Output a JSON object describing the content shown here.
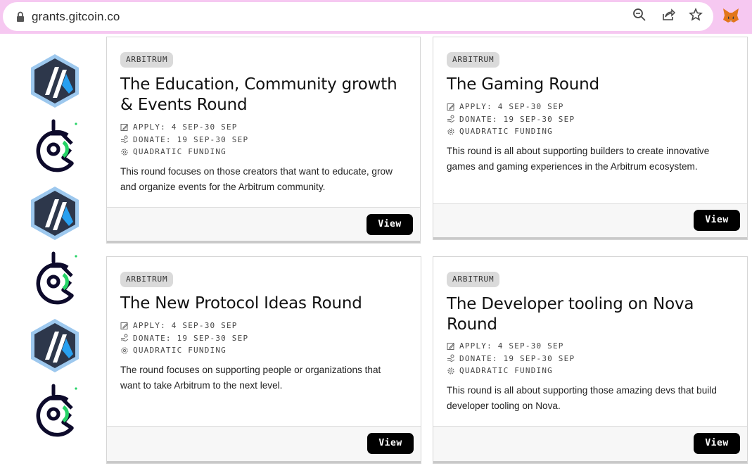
{
  "browser": {
    "url": "grants.gitcoin.co",
    "icons": [
      "lock-icon",
      "zoom-out-icon",
      "share-icon",
      "bookmark-star-icon",
      "metamask-fox-icon"
    ]
  },
  "sidebar": {
    "logos": [
      "arbitrum-logo-icon",
      "gitcoin-logo-icon",
      "arbitrum-logo-icon",
      "gitcoin-logo-icon",
      "arbitrum-logo-icon",
      "gitcoin-logo-icon"
    ]
  },
  "rounds": [
    {
      "tag": "ARBITRUM",
      "title_line1": "The Education, Community growth",
      "title_line2": "& Events Round",
      "apply": "APPLY: 4 SEP-30 SEP",
      "donate": "DONATE: 19 SEP-30 SEP",
      "funding": "QUADRATIC FUNDING",
      "desc_line1": "This round focuses on those creators that want to educate, grow",
      "desc_line2": "and organize events for the Arbitrum community.",
      "button": "View"
    },
    {
      "tag": "ARBITRUM",
      "title_line1": "The Gaming Round",
      "title_line2": "",
      "apply": "APPLY: 4 SEP-30 SEP",
      "donate": "DONATE: 19 SEP-30 SEP",
      "funding": "QUADRATIC FUNDING",
      "desc_line1": "This round is all about supporting builders to create innovative",
      "desc_line2": "games and gaming experiences in the Arbitrum ecosystem.",
      "button": "View"
    },
    {
      "tag": "ARBITRUM",
      "title_line1": "The New Protocol Ideas Round",
      "title_line2": "",
      "apply": "APPLY: 4 SEP-30 SEP",
      "donate": "DONATE: 19 SEP-30 SEP",
      "funding": "QUADRATIC FUNDING",
      "desc_line1": "The round focuses on supporting people or organizations that",
      "desc_line2": "want to take Arbitrum to the next level.",
      "button": "View"
    },
    {
      "tag": "ARBITRUM",
      "title_line1": "The Developer tooling on Nova",
      "title_line2": "Round",
      "apply": "APPLY: 4 SEP-30 SEP",
      "donate": "DONATE: 19 SEP-30 SEP",
      "funding": "QUADRATIC FUNDING",
      "desc_line1": "This round is all about supporting those amazing devs that build",
      "desc_line2": "developer tooling on Nova.",
      "button": "View"
    }
  ]
}
